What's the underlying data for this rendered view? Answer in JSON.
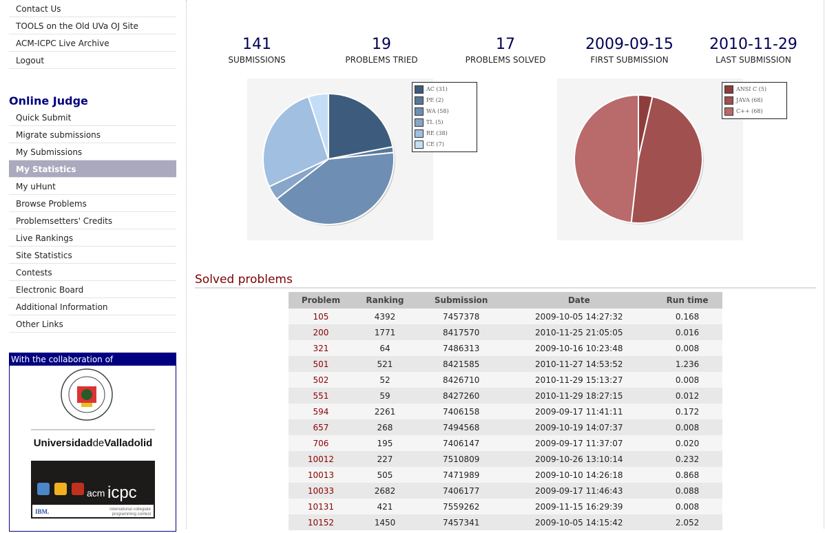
{
  "sidebar": {
    "top_items": [
      "Contact Us",
      "TOOLS on the Old UVa OJ Site",
      "ACM-ICPC Live Archive",
      "Logout"
    ],
    "section_title": "Online Judge",
    "items": [
      "Quick Submit",
      "Migrate submissions",
      "My Submissions",
      "My Statistics",
      "My uHunt",
      "Browse Problems",
      "Problemsetters' Credits",
      "Live Rankings",
      "Site Statistics",
      "Contests",
      "Electronic Board",
      "Additional Information",
      "Other Links"
    ],
    "active": "My Statistics",
    "collab_title": "With the collaboration of",
    "logos": {
      "uva": "Universidad de Valladolid",
      "uva_seal": "DOMUS SAPIENTIAE SIBI ADIFICAVIT",
      "acm": "acm icpc",
      "acm_sub": "international collegiate programming contest",
      "ibm": "IBM event sponsor"
    }
  },
  "stats": [
    {
      "value": "141",
      "label": "SUBMISSIONS"
    },
    {
      "value": "19",
      "label": "PROBLEMS TRIED"
    },
    {
      "value": "17",
      "label": "PROBLEMS SOLVED"
    },
    {
      "value": "2009-09-15",
      "label": "FIRST SUBMISSION"
    },
    {
      "value": "2010-11-29",
      "label": "LAST SUBMISSION"
    }
  ],
  "chart_data": [
    {
      "type": "pie",
      "slices": [
        {
          "label": "AC (31)",
          "value": 31,
          "color": "#3d5c7d"
        },
        {
          "label": "PE (2)",
          "value": 2,
          "color": "#577899"
        },
        {
          "label": "WA (58)",
          "value": 58,
          "color": "#6e8fb3"
        },
        {
          "label": "TL (5)",
          "value": 5,
          "color": "#87a6c8"
        },
        {
          "label": "RE (38)",
          "value": 38,
          "color": "#a1bfe0"
        },
        {
          "label": "CE (7)",
          "value": 7,
          "color": "#c3ddf6"
        }
      ],
      "legend": "top-right"
    },
    {
      "type": "pie",
      "slices": [
        {
          "label": "ANSI C (5)",
          "value": 5,
          "color": "#8e3d3d"
        },
        {
          "label": "JAVA (68)",
          "value": 68,
          "color": "#a15050"
        },
        {
          "label": "C++ (68)",
          "value": 68,
          "color": "#b96a6a"
        }
      ],
      "legend": "top-right"
    }
  ],
  "solved": {
    "title": "Solved problems",
    "columns": [
      "Problem",
      "Ranking",
      "Submission",
      "Date",
      "Run time"
    ],
    "rows": [
      [
        "105",
        "4392",
        "7457378",
        "2009-10-05 14:27:32",
        "0.168"
      ],
      [
        "200",
        "1771",
        "8417570",
        "2010-11-25 21:05:05",
        "0.016"
      ],
      [
        "321",
        "64",
        "7486313",
        "2009-10-16 10:23:48",
        "0.008"
      ],
      [
        "501",
        "521",
        "8421585",
        "2010-11-27 14:53:52",
        "1.236"
      ],
      [
        "502",
        "52",
        "8426710",
        "2010-11-29 15:13:27",
        "0.008"
      ],
      [
        "551",
        "59",
        "8427260",
        "2010-11-29 18:27:15",
        "0.012"
      ],
      [
        "594",
        "2261",
        "7406158",
        "2009-09-17 11:41:11",
        "0.172"
      ],
      [
        "657",
        "268",
        "7494568",
        "2009-10-19 14:07:37",
        "0.008"
      ],
      [
        "706",
        "195",
        "7406147",
        "2009-09-17 11:37:07",
        "0.020"
      ],
      [
        "10012",
        "227",
        "7510809",
        "2009-10-26 13:10:14",
        "0.232"
      ],
      [
        "10013",
        "505",
        "7471989",
        "2009-10-10 14:26:18",
        "0.868"
      ],
      [
        "10033",
        "2682",
        "7406177",
        "2009-09-17 11:46:43",
        "0.088"
      ],
      [
        "10131",
        "421",
        "7559262",
        "2009-11-15 16:29:39",
        "0.008"
      ],
      [
        "10152",
        "1450",
        "7457341",
        "2009-10-05 14:15:42",
        "2.052"
      ]
    ]
  }
}
